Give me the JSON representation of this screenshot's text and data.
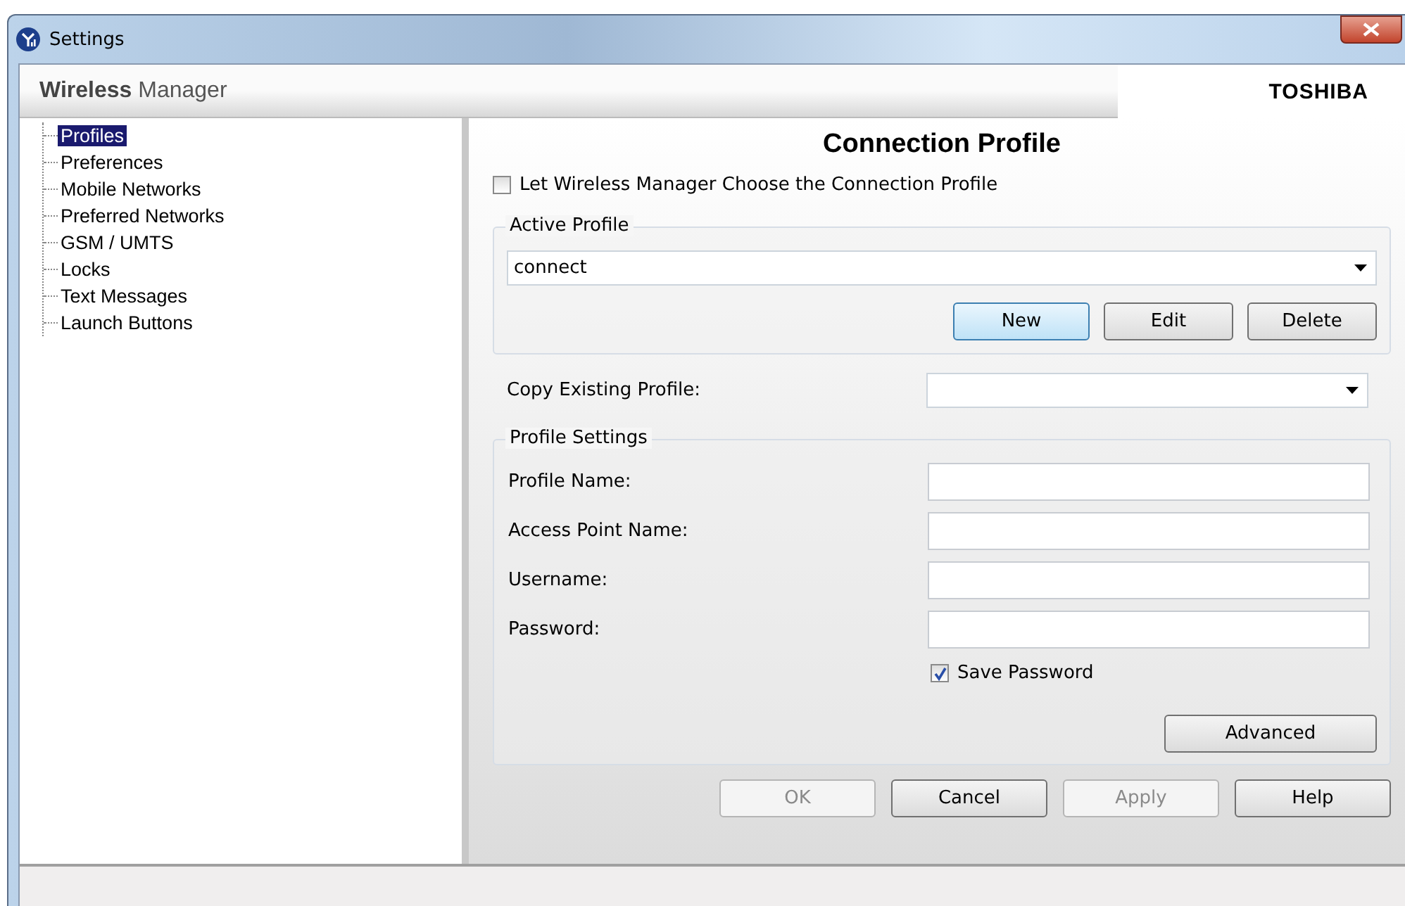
{
  "window": {
    "title": "Settings"
  },
  "header": {
    "title": "**Wireless** Manager",
    "brand": "TOSHIBA"
  },
  "sidebar": {
    "items": [
      {
        "label": "Profiles",
        "selected": true
      },
      {
        "label": "Preferences",
        "selected": false
      },
      {
        "label": "Mobile Networks",
        "selected": false
      },
      {
        "label": "Preferred Networks",
        "selected": false
      },
      {
        "label": "GSM / UMTS",
        "selected": false
      },
      {
        "label": "Locks",
        "selected": false
      },
      {
        "label": "Text Messages",
        "selected": false
      },
      {
        "label": "Launch Buttons",
        "selected": false
      }
    ]
  },
  "content": {
    "heading": "Connection Profile",
    "auto_choose": {
      "label": "Let Wireless Manager Choose the Connection Profile",
      "checked": false
    },
    "active_profile": {
      "legend": "Active Profile",
      "value": "connect",
      "buttons": [
        {
          "label": "New",
          "focused": true
        },
        {
          "label": "Edit",
          "focused": false
        },
        {
          "label": "Delete",
          "focused": false
        }
      ]
    },
    "copy_existing": {
      "label": "Copy Existing Profile:"
    },
    "profile_settings": {
      "legend": "Profile Settings",
      "fields": [
        {
          "label": "Profile Name:"
        },
        {
          "label": "Access Point Name:"
        },
        {
          "label": "Username:"
        },
        {
          "label": "Password:"
        }
      ],
      "save_password": {
        "label": "Save Password",
        "checked": true
      },
      "advanced_button": "Advanced"
    }
  },
  "footer_buttons": [
    {
      "label": "OK",
      "disabled": true
    },
    {
      "label": "Cancel",
      "disabled": false
    },
    {
      "label": "Apply",
      "disabled": true
    },
    {
      "label": "Help",
      "disabled": false
    }
  ]
}
